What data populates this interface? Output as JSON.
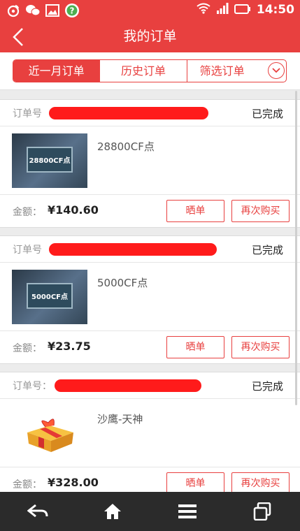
{
  "status_bar": {
    "time": "14:50"
  },
  "header": {
    "title": "我的订单"
  },
  "tabs": [
    {
      "label": "近一月订单",
      "active": true
    },
    {
      "label": "历史订单",
      "active": false
    },
    {
      "label": "筛选订单",
      "active": false
    }
  ],
  "orders": [
    {
      "order_no_label": "订单号",
      "status": "已完成",
      "product": "28800CF点",
      "thumb_text": "28800CF点",
      "amount_label": "金额：",
      "amount": "¥140.60",
      "show_btn": "晒单",
      "rebuy_btn": "再次购买"
    },
    {
      "order_no_label": "订单号",
      "status": "已完成",
      "product": "5000CF点",
      "thumb_text": "5000CF点",
      "amount_label": "金额：",
      "amount": "¥23.75",
      "show_btn": "晒单",
      "rebuy_btn": "再次购买"
    },
    {
      "order_no_label": "订单号：",
      "status": "已完成",
      "product": "沙鹰-天神",
      "thumb_text": "",
      "amount_label": "金额：",
      "amount": "¥328.00",
      "show_btn": "晒单",
      "rebuy_btn": "再次购买"
    }
  ],
  "colors": {
    "brand": "#e8403f",
    "nav_bg": "#2b2b2b"
  }
}
